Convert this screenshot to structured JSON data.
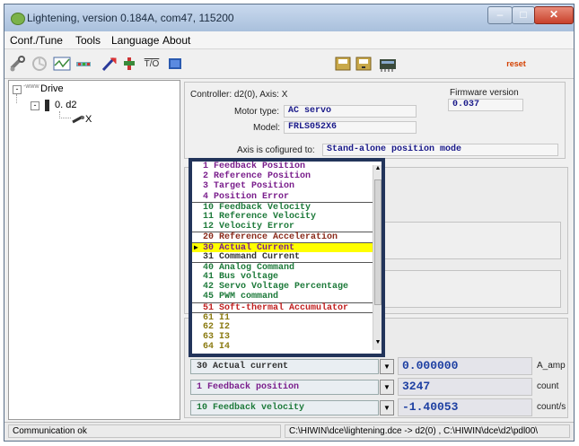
{
  "window": {
    "title": "Lightening, version 0.184A, com47, 115200"
  },
  "menubar": {
    "items": [
      "Conf./Tune",
      "Tools",
      "Language",
      "About"
    ]
  },
  "toolbar": {
    "io_label": "T/O",
    "reset_label": "reset",
    "reset_color": "#d44000"
  },
  "tree": {
    "root": "Drive",
    "root_prefix": "-www",
    "child": "0. d2",
    "leaf": "X"
  },
  "controller": {
    "label": "Controller: d2(0), Axis: X",
    "firmware_label": "Firmware version",
    "firmware_value": "0.037",
    "motor_type_label": "Motor type:",
    "motor_type_value": "AC servo",
    "model_label": "Model:",
    "model_value": "FRLS052X6",
    "axis_config_label": "Axis is cofigured to:",
    "axis_config_value": "Stand-alone position mode"
  },
  "dropdown": {
    "items": [
      {
        "text": "1 Feedback Position",
        "color": "#7a1e8c",
        "sep": false,
        "selected": false
      },
      {
        "text": "2 Reference Position",
        "color": "#7a1e8c",
        "sep": false,
        "selected": false
      },
      {
        "text": "3 Target Position",
        "color": "#7a1e8c",
        "sep": false,
        "selected": false
      },
      {
        "text": "4 Position Error",
        "color": "#7a1e8c",
        "sep": false,
        "selected": false
      },
      {
        "text": "10 Feedback Velocity",
        "color": "#1d7a3a",
        "sep": true,
        "selected": false
      },
      {
        "text": "11 Reference Velocity",
        "color": "#1d7a3a",
        "sep": false,
        "selected": false
      },
      {
        "text": "12 Velocity Error",
        "color": "#1d7a3a",
        "sep": false,
        "selected": false
      },
      {
        "text": "20 Reference Acceleration",
        "color": "#8a2a1a",
        "sep": true,
        "selected": false
      },
      {
        "text": "30 Actual Current",
        "color": "#7a1e8c",
        "sep": true,
        "selected": true
      },
      {
        "text": "31 Command Current",
        "color": "#333333",
        "sep": false,
        "selected": false
      },
      {
        "text": "40 Analog Command",
        "color": "#1d7a3a",
        "sep": true,
        "selected": false
      },
      {
        "text": "41 Bus voltage",
        "color": "#1d7a3a",
        "sep": false,
        "selected": false
      },
      {
        "text": "42 Servo Voltage Percentage",
        "color": "#1d7a3a",
        "sep": false,
        "selected": false
      },
      {
        "text": "45 PWM command",
        "color": "#1d7a3a",
        "sep": false,
        "selected": false
      },
      {
        "text": "51 Soft-thermal Accumulator",
        "color": "#c02020",
        "sep": true,
        "selected": false
      },
      {
        "text": "61 I1",
        "color": "#8a7a10",
        "sep": true,
        "selected": false
      },
      {
        "text": "62 I2",
        "color": "#8a7a10",
        "sep": false,
        "selected": false
      },
      {
        "text": "63 I3",
        "color": "#8a7a10",
        "sep": false,
        "selected": false
      },
      {
        "text": "64 I4",
        "color": "#8a7a10",
        "sep": false,
        "selected": false
      }
    ]
  },
  "monitors": [
    {
      "selection": "30 Actual current",
      "selection_color": "#333333",
      "value": "0.000000",
      "unit": "A_amp"
    },
    {
      "selection": "1 Feedback position",
      "selection_color": "#7a1e8c",
      "value": "3247",
      "unit": "count"
    },
    {
      "selection": "10 Feedback velocity",
      "selection_color": "#1d7a3a",
      "value": "-1.40053",
      "unit": "count/s"
    }
  ],
  "statusbar": {
    "left": "Communication ok",
    "right": "C:\\HIWIN\\dce\\lightening.dce -> d2(0) , C:\\HIWIN\\dce\\d2\\pdl00\\"
  }
}
